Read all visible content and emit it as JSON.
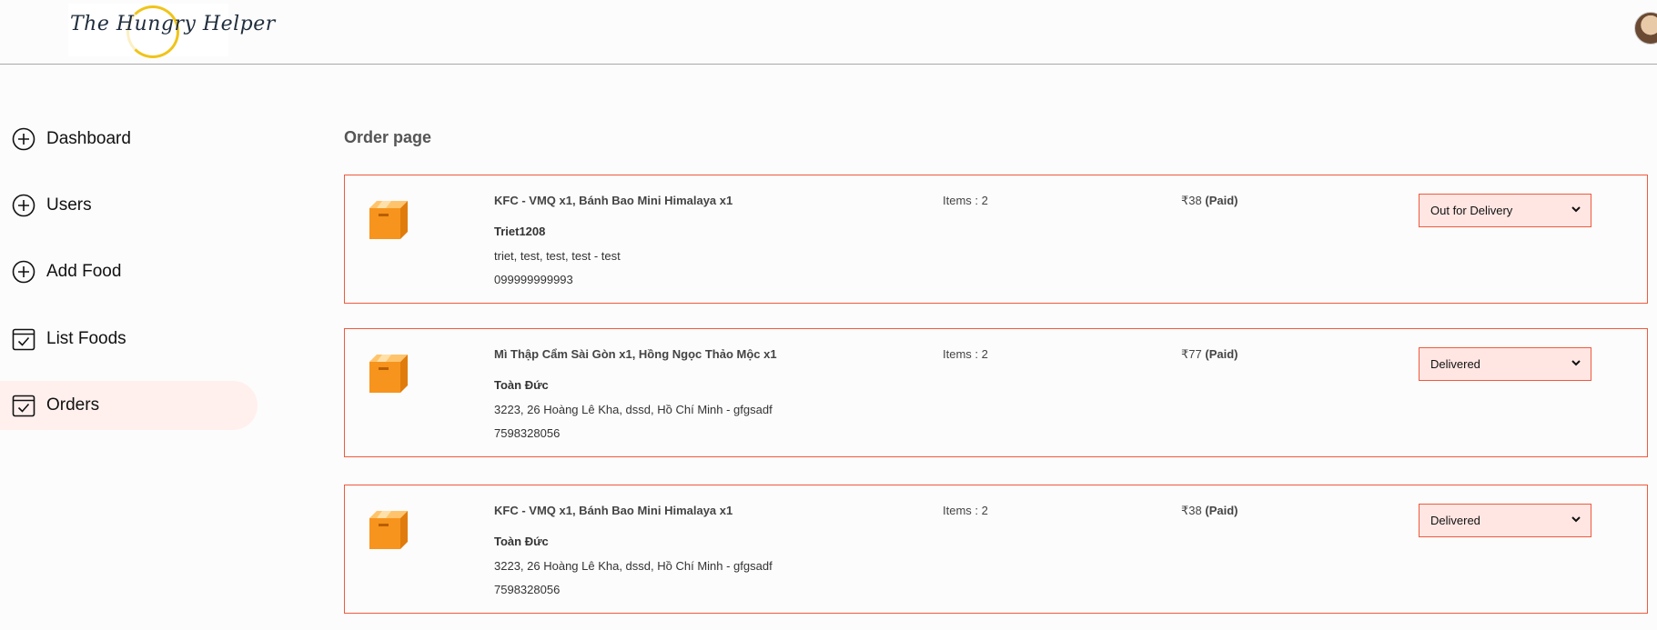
{
  "header": {
    "logo_text": "The Hungry Helper"
  },
  "sidebar": {
    "items": [
      {
        "label": "Dashboard",
        "icon": "plus-circle-icon"
      },
      {
        "label": "Users",
        "icon": "plus-circle-icon"
      },
      {
        "label": "Add Food",
        "icon": "plus-circle-icon"
      },
      {
        "label": "List Foods",
        "icon": "checkbox-icon"
      },
      {
        "label": "Orders",
        "icon": "checkbox-icon",
        "active": true
      }
    ]
  },
  "main": {
    "title": "Order page",
    "orders": [
      {
        "items": "KFC - VMQ x1, Bánh Bao Mini Himalaya x1",
        "name": "Triet1208",
        "address": "triet, test, test, test - test",
        "phone": "099999999993",
        "count": "Items : 2",
        "amount": "₹38",
        "paid": "(Paid)",
        "status": "Out for Delivery"
      },
      {
        "items": "Mì Thập Cẩm Sài Gòn x1, Hồng Ngọc Thảo Mộc x1",
        "name": "Toàn Đức",
        "address": "3223, 26 Hoàng Lê Kha, dssd, Hồ Chí Minh - gfgsadf",
        "phone": "7598328056",
        "count": "Items : 2",
        "amount": "₹77",
        "paid": "(Paid)",
        "status": "Delivered"
      },
      {
        "items": "KFC - VMQ x1, Bánh Bao Mini Himalaya x1",
        "name": "Toàn Đức",
        "address": "3223, 26 Hoàng Lê Kha, dssd, Hồ Chí Minh - gfgsadf",
        "phone": "7598328056",
        "count": "Items : 2",
        "amount": "₹38",
        "paid": "(Paid)",
        "status": "Delivered"
      }
    ]
  },
  "colors": {
    "accent": "#ef5a3f",
    "active_bg": "#fff0ee",
    "select_bg": "#ffe6e3",
    "box_orange": "#f7941d"
  }
}
